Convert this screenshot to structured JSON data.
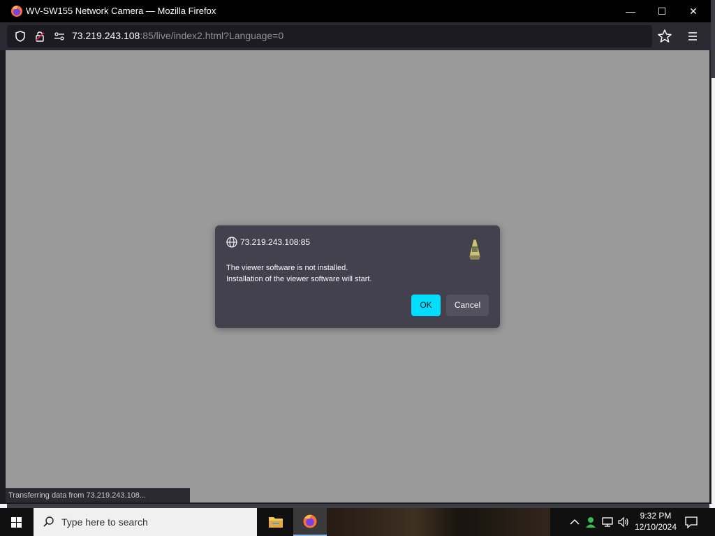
{
  "window": {
    "title": "WV-SW155 Network Camera — Mozilla Firefox",
    "minimize_glyph": "—",
    "maximize_glyph": "☐",
    "close_glyph": "✕"
  },
  "urlbar": {
    "host": "73.219.243.108",
    "rest": ":85/live/index2.html?Language=0"
  },
  "dialog": {
    "origin": "73.219.243.108:85",
    "message_line1": "The viewer software is not installed.",
    "message_line2": "Installation of the viewer software will start.",
    "ok_label": "OK",
    "cancel_label": "Cancel"
  },
  "status_bar": {
    "text": "Transferring data from 73.219.243.108..."
  },
  "taskbar": {
    "search_placeholder": "Type here to search",
    "time": "9:32 PM",
    "date": "12/10/2024"
  },
  "colors": {
    "accent_button": "#00ddff",
    "content_bg": "#9a9a9a",
    "dialog_bg": "#42414d"
  }
}
